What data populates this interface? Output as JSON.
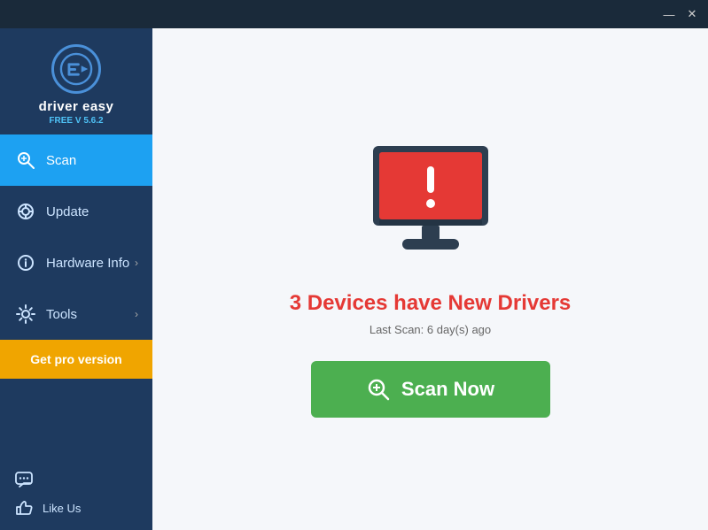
{
  "titlebar": {
    "minimize_label": "—",
    "close_label": "✕"
  },
  "sidebar": {
    "logo_text": "driver easy",
    "logo_version": "FREE V 5.6.2",
    "nav_items": [
      {
        "id": "scan",
        "label": "Scan",
        "active": true,
        "has_arrow": false
      },
      {
        "id": "update",
        "label": "Update",
        "active": false,
        "has_arrow": false
      },
      {
        "id": "hardware-info",
        "label": "Hardware Info",
        "active": false,
        "has_arrow": true
      },
      {
        "id": "tools",
        "label": "Tools",
        "active": false,
        "has_arrow": true
      }
    ],
    "get_pro_label": "Get pro version",
    "bottom_items": [
      {
        "id": "chat",
        "label": ""
      },
      {
        "id": "like-us",
        "label": "Like Us"
      }
    ]
  },
  "main": {
    "alert_title": "3 Devices have New Drivers",
    "last_scan_label": "Last Scan: 6 day(s) ago",
    "scan_button_label": "Scan Now"
  }
}
